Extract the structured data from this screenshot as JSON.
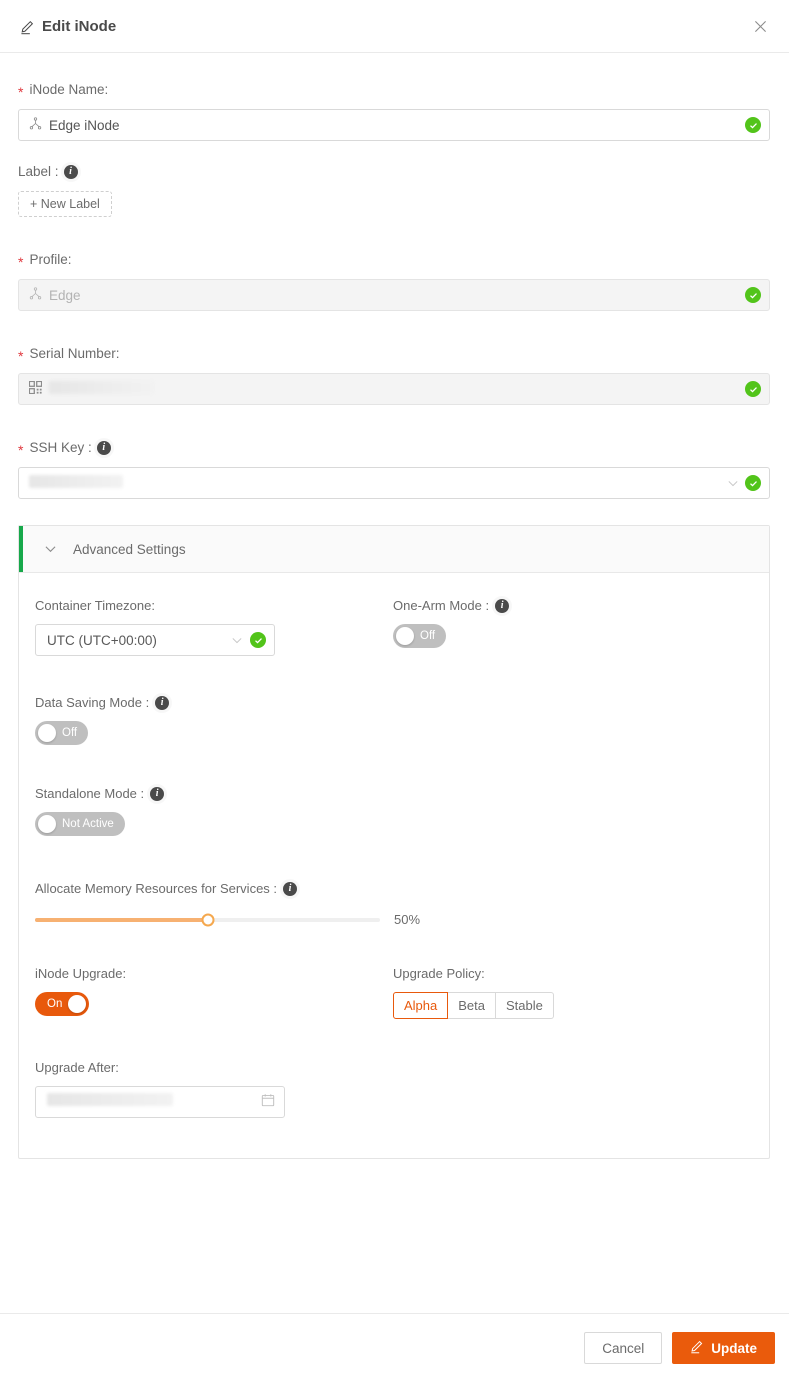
{
  "header": {
    "title": "Edit iNode",
    "edit_icon": "pencil-icon",
    "close_icon": "close-icon"
  },
  "form": {
    "inode_name": {
      "label": "iNode Name:",
      "required": true,
      "icon": "hierarchy-icon",
      "value": "Edge iNode",
      "valid": true
    },
    "label_field": {
      "label": "Label :",
      "info_icon": "info-icon",
      "new_label_button": "+ New Label"
    },
    "profile": {
      "label": "Profile:",
      "required": true,
      "icon": "hierarchy-icon",
      "value": "Edge",
      "disabled": true,
      "valid": true
    },
    "serial_number": {
      "label": "Serial Number:",
      "required": true,
      "icon": "qr-code-icon",
      "value": "",
      "redacted": true,
      "disabled": true,
      "valid": true
    },
    "ssh_key": {
      "label": "SSH Key :",
      "required": true,
      "info_icon": "info-icon",
      "value": "",
      "redacted": true,
      "valid": true
    }
  },
  "advanced": {
    "title": "Advanced Settings",
    "expanded": true,
    "chevron_icon": "chevron-down-icon",
    "accent_color": "#17a84a",
    "container_timezone": {
      "label": "Container Timezone:",
      "value": "UTC (UTC+00:00)",
      "valid": true
    },
    "one_arm_mode": {
      "label": "One-Arm Mode :",
      "info_icon": "info-icon",
      "state": "off",
      "state_text": "Off"
    },
    "data_saving_mode": {
      "label": "Data Saving Mode :",
      "info_icon": "info-icon",
      "state": "off",
      "state_text": "Off"
    },
    "standalone_mode": {
      "label": "Standalone Mode :",
      "info_icon": "info-icon",
      "state": "off",
      "state_text": "Not Active"
    },
    "allocate_memory": {
      "label": "Allocate Memory Resources for Services :",
      "info_icon": "info-icon",
      "percent": 50,
      "percent_text": "50%",
      "min": 0,
      "max": 100,
      "fill_color": "#f7b172"
    },
    "inode_upgrade": {
      "label": "iNode Upgrade:",
      "state": "on",
      "state_text": "On",
      "on_color": "#e8590c"
    },
    "upgrade_policy": {
      "label": "Upgrade Policy:",
      "options": [
        "Alpha",
        "Beta",
        "Stable"
      ],
      "selected": "Alpha",
      "selected_color": "#e8590c"
    },
    "upgrade_after": {
      "label": "Upgrade After:",
      "value": "",
      "redacted": true,
      "calendar_icon": "calendar-icon"
    }
  },
  "footer": {
    "cancel_label": "Cancel",
    "update_label": "Update",
    "update_icon": "pencil-icon",
    "update_color": "#ea5b0c"
  }
}
